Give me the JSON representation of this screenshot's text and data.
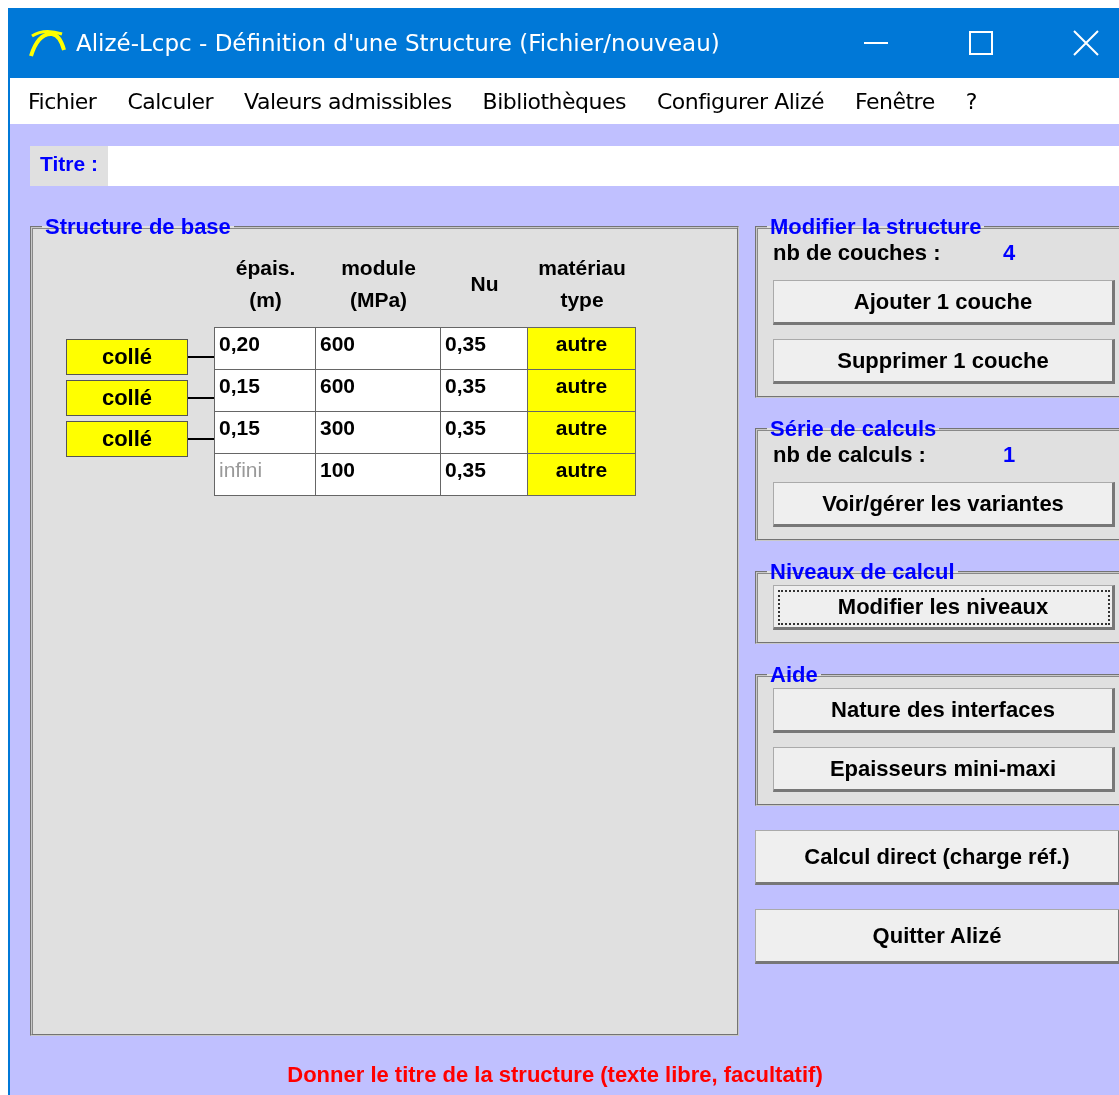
{
  "window": {
    "title": "Alizé-Lcpc - Définition d'une Structure (Fichier/nouveau)"
  },
  "menu": [
    "Fichier",
    "Calculer",
    "Valeurs admissibles",
    "Bibliothèques",
    "Configurer Alizé",
    "Fenêtre",
    "?"
  ],
  "title_field": {
    "label": "Titre :"
  },
  "base_structure": {
    "title": "Structure de base",
    "columns": [
      {
        "line1": "épais.",
        "line2": "(m)"
      },
      {
        "line1": "module",
        "line2": "(MPa)"
      },
      {
        "line1": "Nu"
      },
      {
        "line1": "matériau",
        "line2": "type"
      }
    ],
    "layers": [
      {
        "thickness": "0,20",
        "greyed": false,
        "modulus": "600",
        "nu": "0,35",
        "material": "autre"
      },
      {
        "thickness": "0,15",
        "greyed": false,
        "modulus": "600",
        "nu": "0,35",
        "material": "autre"
      },
      {
        "thickness": "0,15",
        "greyed": false,
        "modulus": "300",
        "nu": "0,35",
        "material": "autre"
      },
      {
        "thickness": "infini",
        "greyed": true,
        "modulus": "100",
        "nu": "0,35",
        "material": "autre"
      }
    ],
    "interfaces": [
      "collé",
      "collé",
      "collé"
    ]
  },
  "groups": [
    {
      "title": "Modifier la structure",
      "count_label": "nb de couches :",
      "count": "4",
      "buttons": [
        {
          "label": "Ajouter 1 couche",
          "focused": false
        },
        {
          "label": "Supprimer 1 couche",
          "focused": false
        }
      ]
    },
    {
      "title": "Série de calculs",
      "count_label": "nb de calculs :",
      "count": "1",
      "buttons": [
        {
          "label": "Voir/gérer les variantes",
          "focused": false
        }
      ]
    },
    {
      "title": "Niveaux de calcul",
      "buttons": [
        {
          "label": "Modifier les niveaux",
          "focused": true
        }
      ]
    },
    {
      "title": "Aide",
      "buttons": [
        {
          "label": "Nature des interfaces",
          "focused": false
        },
        {
          "label": "Epaisseurs mini-maxi",
          "focused": false
        }
      ]
    }
  ],
  "actions": [
    "Calcul direct (charge réf.)",
    "Quitter Alizé"
  ],
  "status": "Donner le titre de la structure (texte libre, facultatif)"
}
